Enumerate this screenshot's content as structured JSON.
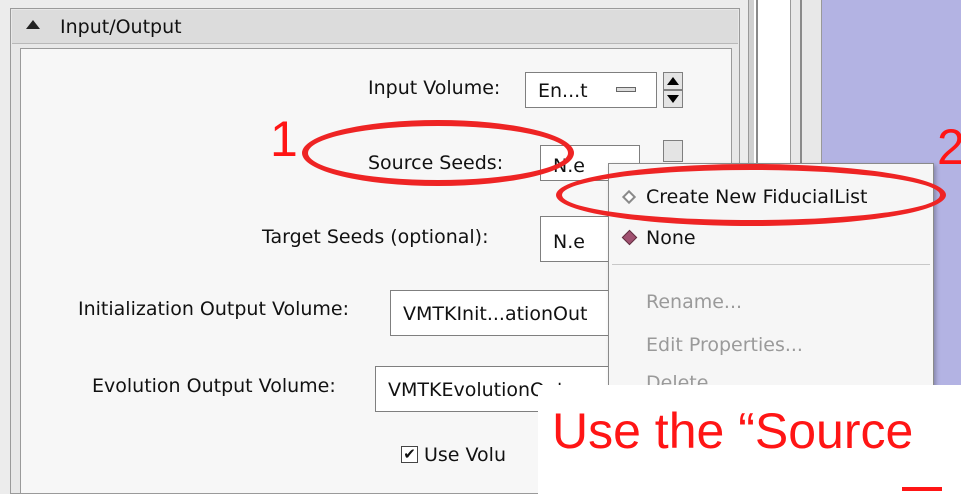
{
  "panel": {
    "header": "Input/Output"
  },
  "form": {
    "input_volume_label": "Input Volume:",
    "input_volume_value": "En...t",
    "source_seeds_label": "Source Seeds:",
    "source_seeds_value": "N.e",
    "target_seeds_label": "Target Seeds (optional):",
    "target_seeds_value": "N.e",
    "init_output_label": "Initialization Output Volume:",
    "init_output_value": "VMTKInit...ationOut",
    "evolution_output_label": "Evolution Output Volume:",
    "evolution_output_value": "VMTKEvolutionOut",
    "use_volume_label": "Use Volu",
    "use_volume_checked": true
  },
  "context_menu": {
    "create_new": "Create New FiducialList",
    "none": "None",
    "rename": "Rename...",
    "edit_properties": "Edit Properties...",
    "delete": "Delete"
  },
  "annotations": {
    "step1": "1",
    "step2": "2",
    "instruction": "Use the “Source"
  },
  "colors": {
    "annotation_red": "#ff1515",
    "purple_background": "#b3b3e3",
    "selected_item_diamond": "#a05070"
  },
  "icons": {
    "collapse": "triangle-up-icon",
    "spin_up": "arrow-up-icon",
    "spin_down": "arrow-down-icon",
    "menu_item_unselected": "hollow-diamond-icon",
    "menu_item_selected": "filled-diamond-icon"
  }
}
